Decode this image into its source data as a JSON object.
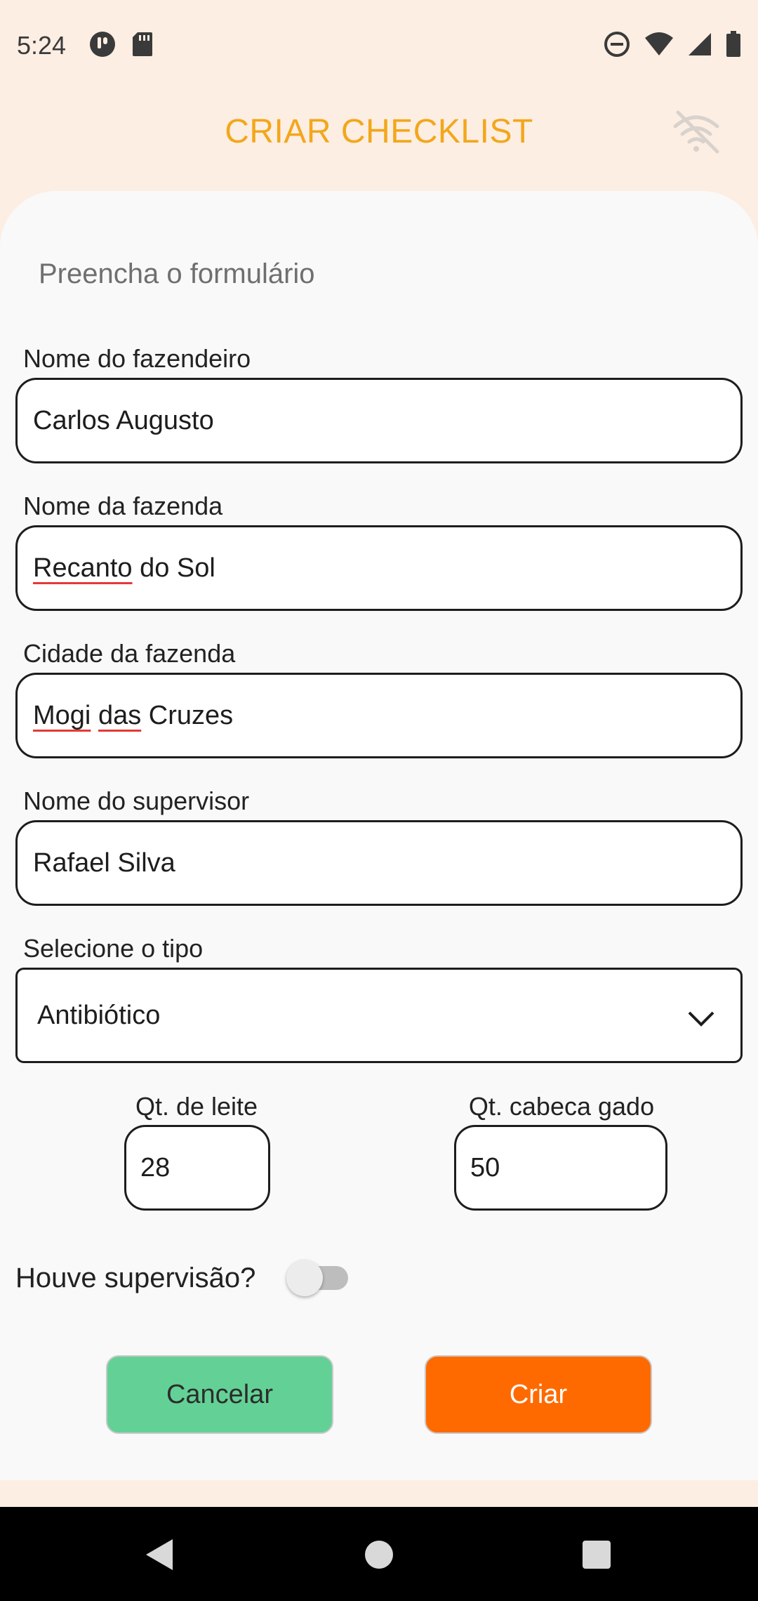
{
  "status_bar": {
    "time": "5:24",
    "left_icons": [
      "talkback-icon",
      "sd-card-icon"
    ],
    "right_icons": [
      "dnd-icon",
      "wifi-icon",
      "signal-icon",
      "battery-icon"
    ]
  },
  "header": {
    "title": "CRIAR CHECKLIST",
    "offline_icon": "wifi-off-icon"
  },
  "form": {
    "heading": "Preencha o formulário",
    "farmer": {
      "label": "Nome do fazendeiro",
      "value": "Carlos Augusto"
    },
    "farm": {
      "label": "Nome da fazenda",
      "value_misspelled": "Recanto",
      "value_rest": " do Sol"
    },
    "city": {
      "label": "Cidade da fazenda",
      "word1": "Mogi",
      "space1": " ",
      "word2": "das",
      "rest": " Cruzes"
    },
    "supervisor": {
      "label": "Nome do supervisor",
      "value": "Rafael Silva"
    },
    "type": {
      "label": "Selecione o tipo",
      "value": "Antibiótico"
    },
    "milk": {
      "label": "Qt. de leite",
      "value": "28"
    },
    "cattle": {
      "label": "Qt. cabeca gado",
      "value": "50"
    },
    "supervision": {
      "label": "Houve supervisão?",
      "checked": false
    }
  },
  "actions": {
    "cancel_label": "Cancelar",
    "create_label": "Criar"
  },
  "colors": {
    "title": "#f2a71b",
    "cancel": "#63d196",
    "create": "#ff6a00",
    "background": "#fdeee3"
  }
}
